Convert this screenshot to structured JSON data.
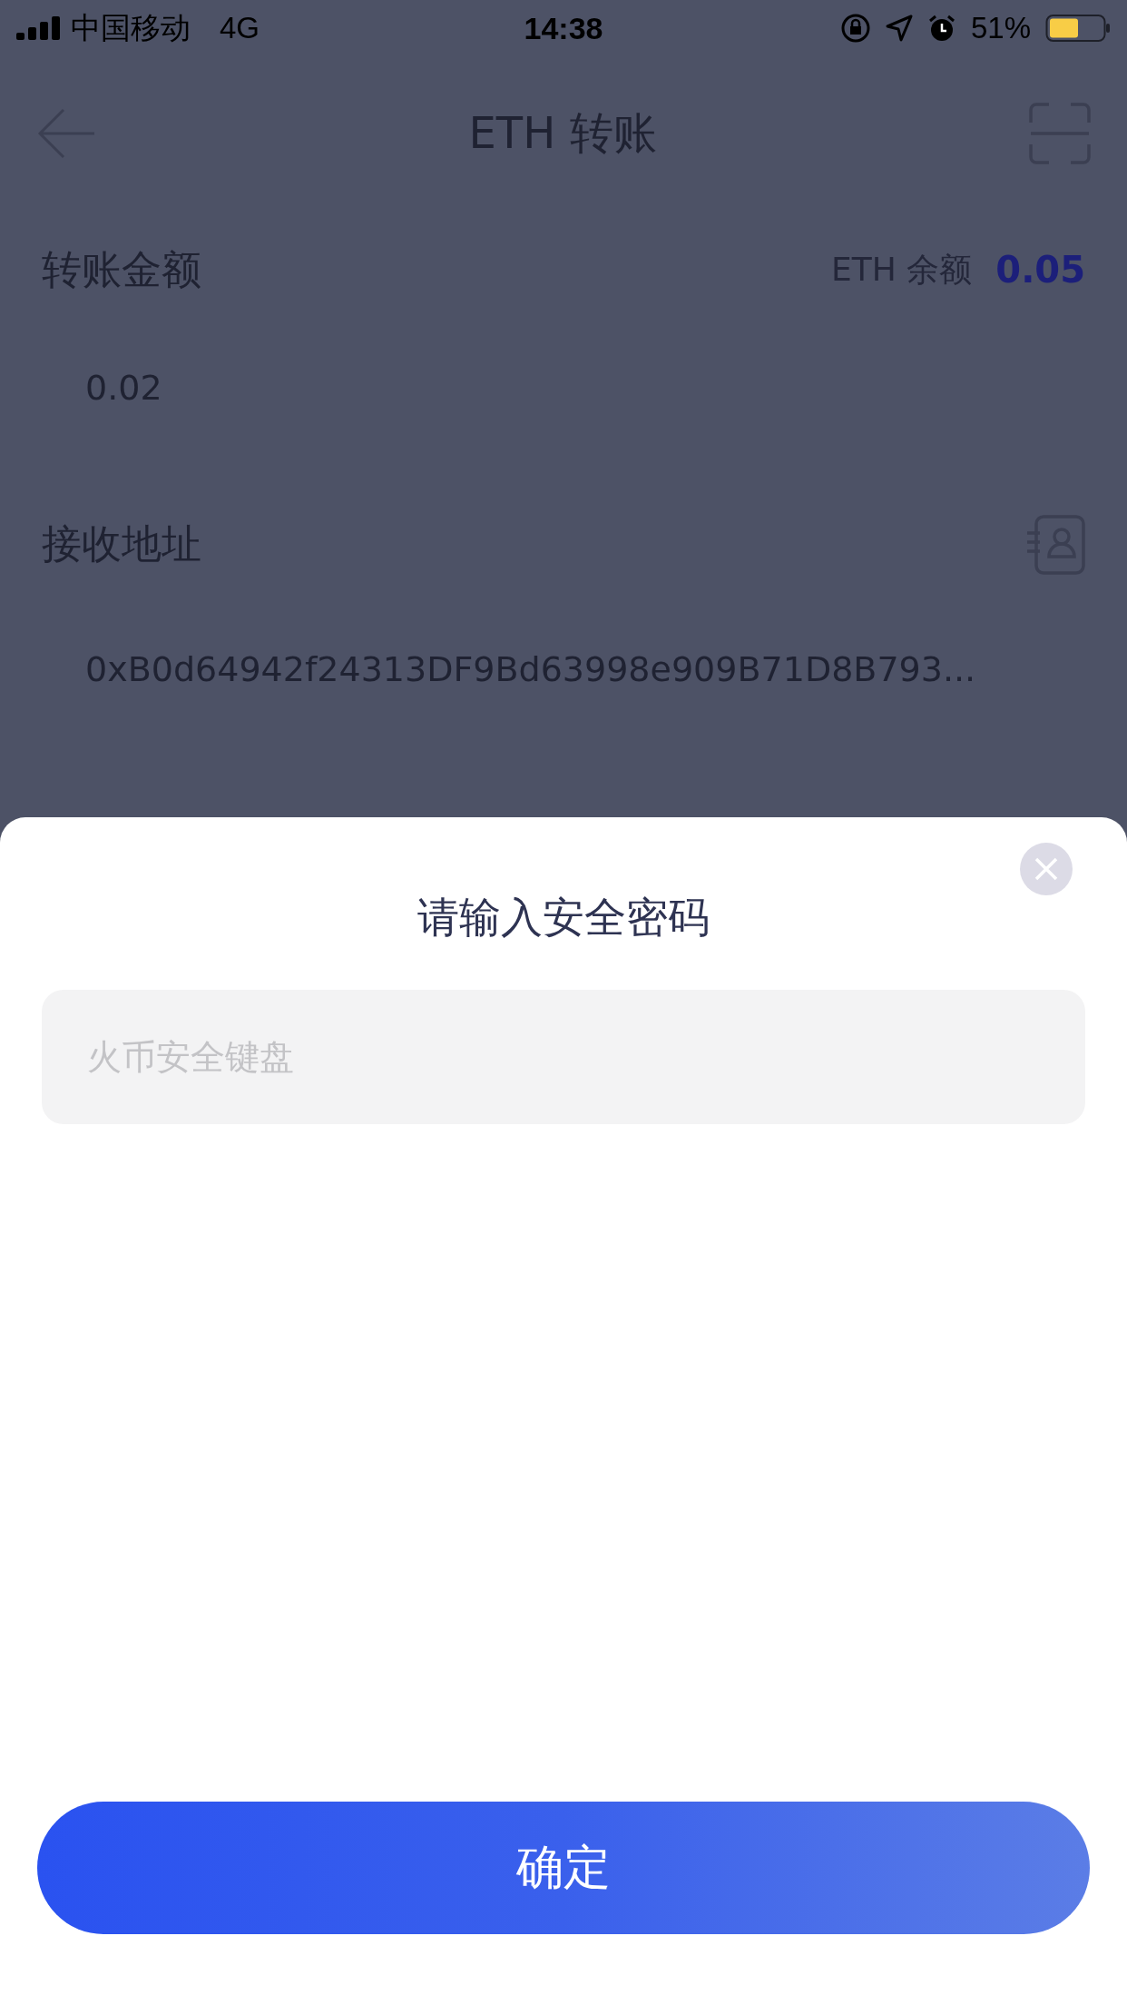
{
  "status_bar": {
    "carrier": "中国移动",
    "network": "4G",
    "time": "14:38",
    "battery": "51%"
  },
  "header": {
    "title": "ETH 转账"
  },
  "amount": {
    "label": "转账金额",
    "balance_label": "ETH 余额",
    "balance": "0.05",
    "value": "0.02"
  },
  "address": {
    "label": "接收地址",
    "value": "0xB0d64942f24313DF9Bd63998e909B71D8B793..."
  },
  "dialog": {
    "title": "请输入安全密码",
    "password_field": {
      "placeholder": "火币安全键盘"
    },
    "confirm_button": "确定"
  }
}
